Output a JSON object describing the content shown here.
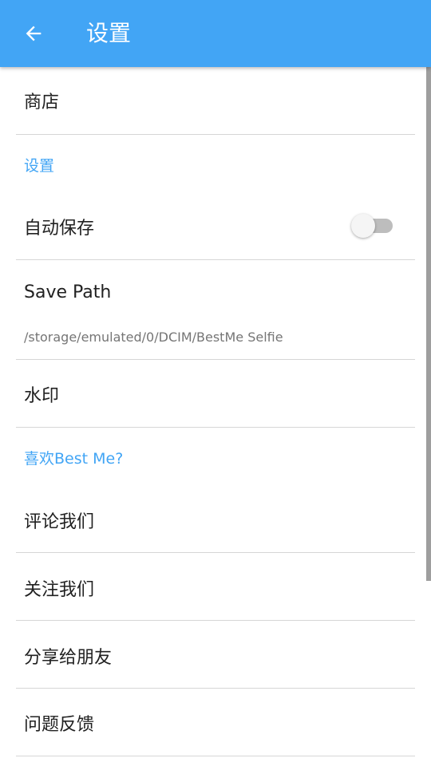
{
  "appbar": {
    "title": "设置",
    "back_icon": "arrow-left-icon",
    "background_color": "#42a5f5"
  },
  "rows": {
    "store": "商店",
    "auto_save": "自动保存",
    "save_path_label": "Save Path",
    "save_path_value": "/storage/emulated/0/DCIM/BestMe Selfie",
    "watermark": "水印",
    "rate_us": "评论我们",
    "follow_us": "关注我们",
    "share_friends": "分享给朋友",
    "feedback": "问题反馈"
  },
  "sections": {
    "settings": "设置",
    "like_app": "喜欢Best Me?"
  },
  "toggles": {
    "auto_save_on": false
  },
  "colors": {
    "accent": "#42a5f5",
    "divider": "#d6d6d6"
  }
}
